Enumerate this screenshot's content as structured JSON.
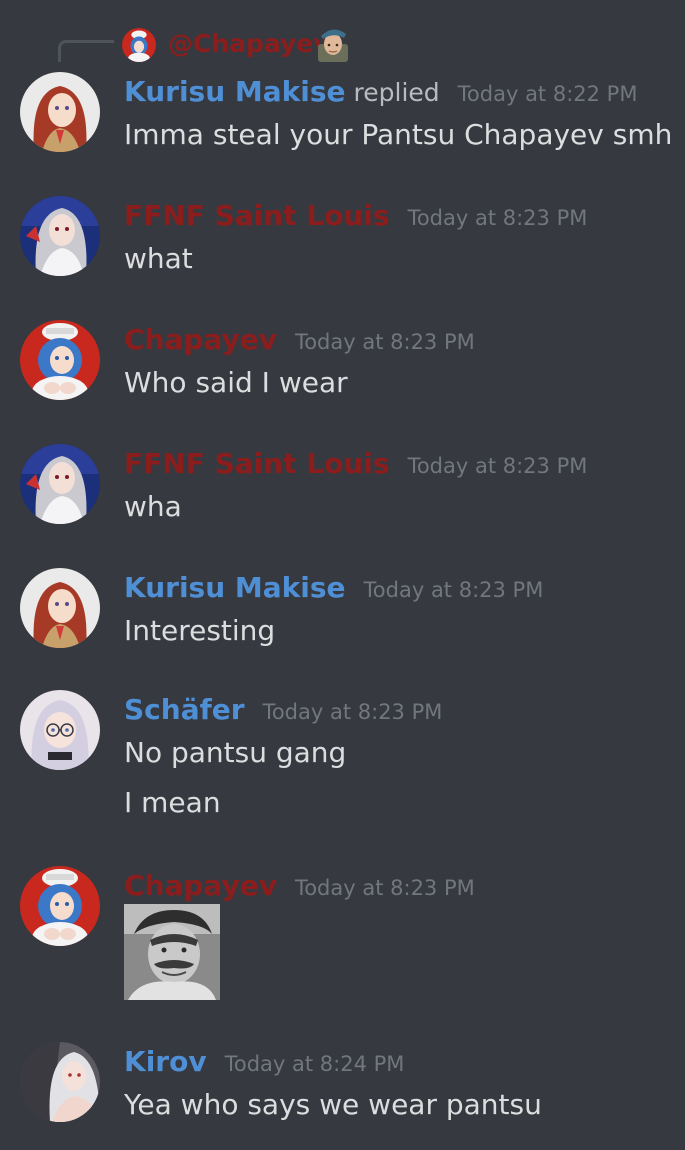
{
  "reply_reference": {
    "mention": "@Chapayev",
    "badge_icon": "soldier-beret-icon"
  },
  "messages": [
    {
      "author": "Kurisu Makise",
      "author_color": "#4f8fd6",
      "replied_label": "replied",
      "timestamp": "Today at 8:22 PM",
      "lines": [
        "Imma steal your Pantsu Chapayev smh"
      ]
    },
    {
      "author": "FFNF Saint Louis",
      "author_color": "#8b1d1d",
      "timestamp": "Today at 8:23 PM",
      "lines": [
        "what"
      ]
    },
    {
      "author": "Chapayev",
      "author_color": "#8b1d1d",
      "timestamp": "Today at 8:23 PM",
      "lines": [
        "Who said I wear"
      ]
    },
    {
      "author": "FFNF Saint Louis",
      "author_color": "#8b1d1d",
      "timestamp": "Today at 8:23 PM",
      "lines": [
        "wha"
      ]
    },
    {
      "author": "Kurisu Makise",
      "author_color": "#4f8fd6",
      "timestamp": "Today at 8:23 PM",
      "lines": [
        "Interesting"
      ]
    },
    {
      "author": "Schäfer",
      "author_color": "#4f8fd6",
      "timestamp": "Today at 8:23 PM",
      "lines": [
        "No pantsu gang",
        "I mean"
      ]
    },
    {
      "author": "Chapayev",
      "author_color": "#8b1d1d",
      "timestamp": "Today at 8:23 PM",
      "attachment_icon": "grayscale-portrait-photo"
    },
    {
      "author": "Kirov",
      "author_color": "#4f8fd6",
      "timestamp": "Today at 8:24 PM",
      "lines": [
        "Yea who says we wear pantsu"
      ]
    }
  ],
  "colors": {
    "background": "#36393f",
    "message_text": "#dcddde",
    "timestamp": "#72767d",
    "role_blue": "#4f8fd6",
    "role_red": "#8b1d1d"
  }
}
